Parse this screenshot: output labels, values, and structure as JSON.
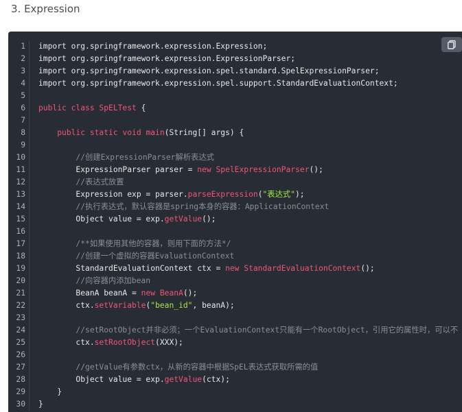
{
  "heading": "3. Expression",
  "copy_icon": "copy-icon",
  "lines": [
    [
      {
        "t": "plain",
        "v": "import org.springframework.expression.Expression;"
      }
    ],
    [
      {
        "t": "plain",
        "v": "import org.springframework.expression.ExpressionParser;"
      }
    ],
    [
      {
        "t": "plain",
        "v": "import org.springframework.expression.spel.standard.SpelExpressionParser;"
      }
    ],
    [
      {
        "t": "plain",
        "v": "import org.springframework.expression.spel.support.StandardEvaluationContext;"
      }
    ],
    [],
    [
      {
        "t": "kw",
        "v": "public class "
      },
      {
        "t": "fn",
        "v": "SpELTest"
      },
      {
        "t": "plain",
        "v": " {"
      }
    ],
    [],
    [
      {
        "t": "plain",
        "v": "    "
      },
      {
        "t": "kw",
        "v": "public static void "
      },
      {
        "t": "fn",
        "v": "main"
      },
      {
        "t": "plain",
        "v": "(String[] args) {"
      }
    ],
    [],
    [
      {
        "t": "plain",
        "v": "        "
      },
      {
        "t": "cm",
        "v": "//创建ExpressionParser解析表达式"
      }
    ],
    [
      {
        "t": "plain",
        "v": "        ExpressionParser parser = "
      },
      {
        "t": "kw",
        "v": "new "
      },
      {
        "t": "fn",
        "v": "SpelExpressionParser"
      },
      {
        "t": "plain",
        "v": "();"
      }
    ],
    [
      {
        "t": "plain",
        "v": "        "
      },
      {
        "t": "cm",
        "v": "//表达式放置"
      }
    ],
    [
      {
        "t": "plain",
        "v": "        Expression exp = parser."
      },
      {
        "t": "fn",
        "v": "parseExpression"
      },
      {
        "t": "plain",
        "v": "("
      },
      {
        "t": "str",
        "v": "\"表达式\""
      },
      {
        "t": "plain",
        "v": ");"
      }
    ],
    [
      {
        "t": "plain",
        "v": "        "
      },
      {
        "t": "cm",
        "v": "//执行表达式，默认容器是spring本身的容器：ApplicationContext"
      }
    ],
    [
      {
        "t": "plain",
        "v": "        Object value = exp."
      },
      {
        "t": "fn",
        "v": "getValue"
      },
      {
        "t": "plain",
        "v": "();"
      }
    ],
    [],
    [
      {
        "t": "plain",
        "v": "        "
      },
      {
        "t": "cm",
        "v": "/**如果使用其他的容器，则用下面的方法*/"
      }
    ],
    [
      {
        "t": "plain",
        "v": "        "
      },
      {
        "t": "cm",
        "v": "//创建一个虚拟的容器EvaluationContext"
      }
    ],
    [
      {
        "t": "plain",
        "v": "        StandardEvaluationContext ctx = "
      },
      {
        "t": "kw",
        "v": "new "
      },
      {
        "t": "fn",
        "v": "StandardEvaluationContext"
      },
      {
        "t": "plain",
        "v": "();"
      }
    ],
    [
      {
        "t": "plain",
        "v": "        "
      },
      {
        "t": "cm",
        "v": "//向容器内添加bean"
      }
    ],
    [
      {
        "t": "plain",
        "v": "        BeanA beanA = "
      },
      {
        "t": "kw",
        "v": "new "
      },
      {
        "t": "fn",
        "v": "BeanA"
      },
      {
        "t": "plain",
        "v": "();"
      }
    ],
    [
      {
        "t": "plain",
        "v": "        ctx."
      },
      {
        "t": "fn",
        "v": "setVariable"
      },
      {
        "t": "plain",
        "v": "("
      },
      {
        "t": "str",
        "v": "\"bean_id\""
      },
      {
        "t": "plain",
        "v": ", beanA);"
      }
    ],
    [],
    [
      {
        "t": "plain",
        "v": "        "
      },
      {
        "t": "cm",
        "v": "//setRootObject并非必须；一个EvaluationContext只能有一个RootObject，引用它的属性时，可以不"
      }
    ],
    [
      {
        "t": "plain",
        "v": "        ctx."
      },
      {
        "t": "fn",
        "v": "setRootObject"
      },
      {
        "t": "plain",
        "v": "(XXX);"
      }
    ],
    [],
    [
      {
        "t": "plain",
        "v": "        "
      },
      {
        "t": "cm",
        "v": "//getValue有参数ctx，从新的容器中根据SpEL表达式获取所需的值"
      }
    ],
    [
      {
        "t": "plain",
        "v": "        Object value = exp."
      },
      {
        "t": "fn",
        "v": "getValue"
      },
      {
        "t": "plain",
        "v": "(ctx);"
      }
    ],
    [
      {
        "t": "plain",
        "v": "    }"
      }
    ],
    [
      {
        "t": "plain",
        "v": "}"
      }
    ]
  ],
  "line_numbers": [
    "1",
    "2",
    "3",
    "4",
    "5",
    "6",
    "7",
    "8",
    "9",
    "10",
    "11",
    "12",
    "13",
    "14",
    "15",
    "16",
    "17",
    "18",
    "19",
    "20",
    "21",
    "22",
    "23",
    "24",
    "25",
    "26",
    "27",
    "28",
    "29",
    "30"
  ],
  "colors": {
    "background": "#282c34",
    "keyword": "#f05578",
    "string": "#a5e844",
    "comment": "#8b8f98",
    "text": "#e8e8e8"
  }
}
